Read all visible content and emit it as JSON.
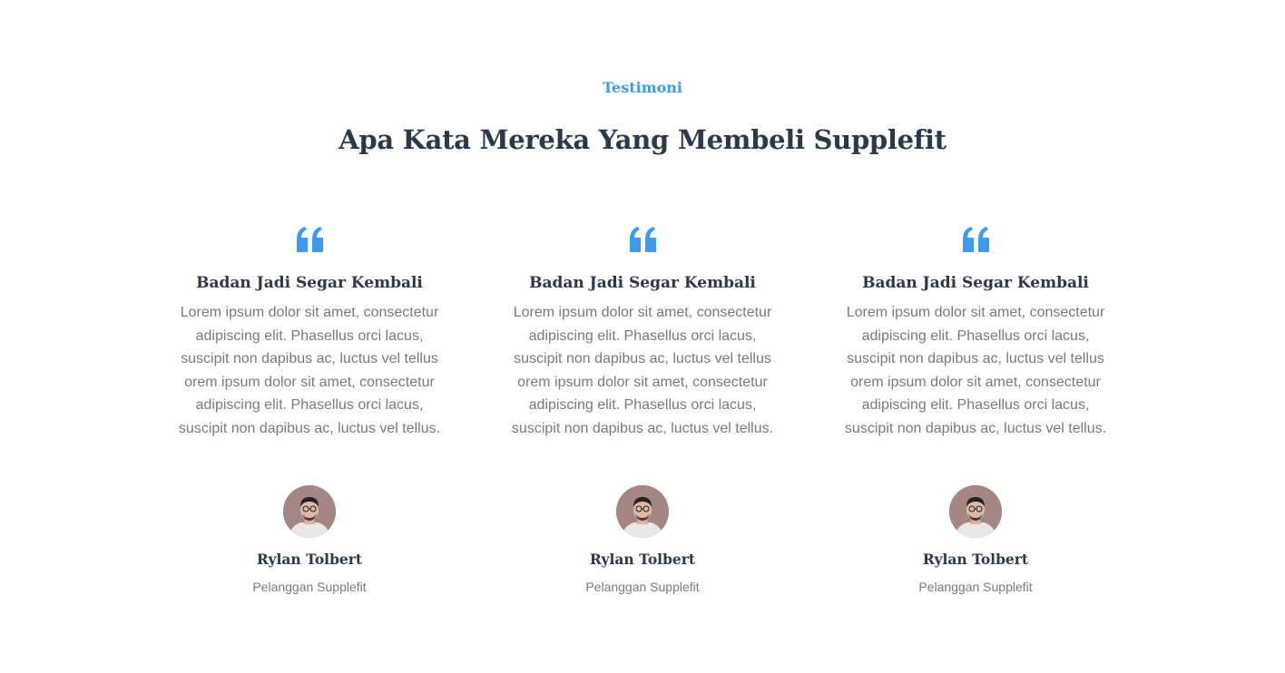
{
  "section": {
    "eyebrow": "Testimoni",
    "heading": "Apa Kata Mereka Yang Membeli Supplefit"
  },
  "colors": {
    "accent": "#3d9be9",
    "heading": "#2b3a4a",
    "body_text": "#7a7a7a",
    "background": "#ffffff"
  },
  "testimonials": [
    {
      "icon": "quote-icon",
      "title": "Badan Jadi Segar Kembali",
      "body": "Lorem ipsum dolor sit amet, consectetur adipiscing elit. Phasellus orci lacus, suscipit non dapibus ac, luctus vel tellus orem ipsum dolor sit amet, consectetur adipiscing elit. Phasellus orci lacus, suscipit non dapibus ac, luctus vel tellus.",
      "author": "Rylan Tolbert",
      "role": "Pelanggan Supplefit"
    },
    {
      "icon": "quote-icon",
      "title": "Badan Jadi Segar Kembali",
      "body": "Lorem ipsum dolor sit amet, consectetur adipiscing elit. Phasellus orci lacus, suscipit non dapibus ac, luctus vel tellus orem ipsum dolor sit amet, consectetur adipiscing elit. Phasellus orci lacus, suscipit non dapibus ac, luctus vel tellus.",
      "author": "Rylan Tolbert",
      "role": "Pelanggan Supplefit"
    },
    {
      "icon": "quote-icon",
      "title": "Badan Jadi Segar Kembali",
      "body": "Lorem ipsum dolor sit amet, consectetur adipiscing elit. Phasellus orci lacus, suscipit non dapibus ac, luctus vel tellus orem ipsum dolor sit amet, consectetur adipiscing elit. Phasellus orci lacus, suscipit non dapibus ac, luctus vel tellus.",
      "author": "Rylan Tolbert",
      "role": "Pelanggan Supplefit"
    }
  ]
}
